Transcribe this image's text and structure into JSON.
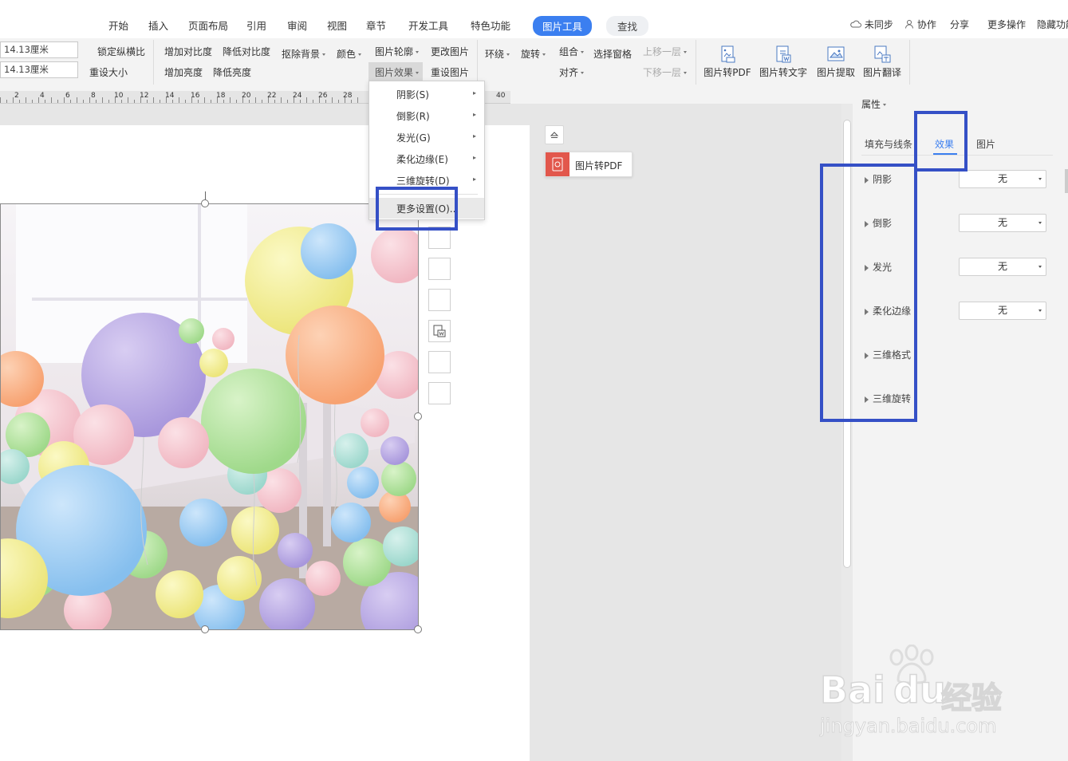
{
  "tabs": [
    "开始",
    "插入",
    "页面布局",
    "引用",
    "审阅",
    "视图",
    "章节",
    "开发工具",
    "特色功能",
    "图片工具",
    "查找"
  ],
  "header_right": {
    "sync": "未同步",
    "collab": "协作",
    "share": "分享",
    "more": "更多操作",
    "hide": "隐藏功能"
  },
  "size": {
    "height": "14.13厘米",
    "width": "14.13厘米",
    "lock_ratio": "锁定纵横比",
    "reset_size": "重设大小"
  },
  "ribbon": {
    "inc_contrast": "增加对比度",
    "dec_contrast": "降低对比度",
    "remove_bg": "抠除背景",
    "color": "颜色",
    "inc_brightness": "增加亮度",
    "dec_brightness": "降低亮度",
    "outline": "图片轮廓",
    "change_pic": "更改图片",
    "effects": "图片效果",
    "reset_pic": "重设图片",
    "wrap": "环绕",
    "rotate": "旋转",
    "group": "组合",
    "select_pane": "选择窗格",
    "bring_forward": "上移一层",
    "align": "对齐",
    "send_backward": "下移一层",
    "pic_to_pdf": "图片转PDF",
    "pic_to_text": "图片转文字",
    "pic_extract": "图片提取",
    "pic_translate": "图片翻译"
  },
  "ruler": [
    "2",
    "4",
    "6",
    "8",
    "10",
    "12",
    "14",
    "16",
    "18",
    "20",
    "22",
    "24",
    "26",
    "28",
    "40"
  ],
  "effects_menu": [
    {
      "label": "阴影(S)",
      "has_submenu": true
    },
    {
      "label": "倒影(R)",
      "has_submenu": true
    },
    {
      "label": "发光(G)",
      "has_submenu": true
    },
    {
      "label": "柔化边缘(E)",
      "has_submenu": true
    },
    {
      "label": "三维旋转(D)",
      "has_submenu": true
    },
    {
      "label": "更多设置(O)...",
      "has_submenu": false
    }
  ],
  "float_button": "图片转PDF",
  "panel": {
    "title": "属性",
    "tabs": [
      "填充与线条",
      "效果",
      "图片"
    ],
    "active_tab": "效果",
    "rows": [
      {
        "label": "阴影",
        "value": "无"
      },
      {
        "label": "倒影",
        "value": "无"
      },
      {
        "label": "发光",
        "value": "无"
      },
      {
        "label": "柔化边缘",
        "value": "无"
      },
      {
        "label": "三维格式",
        "value": ""
      },
      {
        "label": "三维旋转",
        "value": ""
      }
    ]
  },
  "watermark": {
    "brand": "Bai",
    "brand2": "du",
    "cn": "经验",
    "url": "jingyan.baidu.com"
  },
  "colors": {
    "accent": "#3b7ff0",
    "highlight": "#3550c6",
    "pdf_red": "#e2574c"
  }
}
